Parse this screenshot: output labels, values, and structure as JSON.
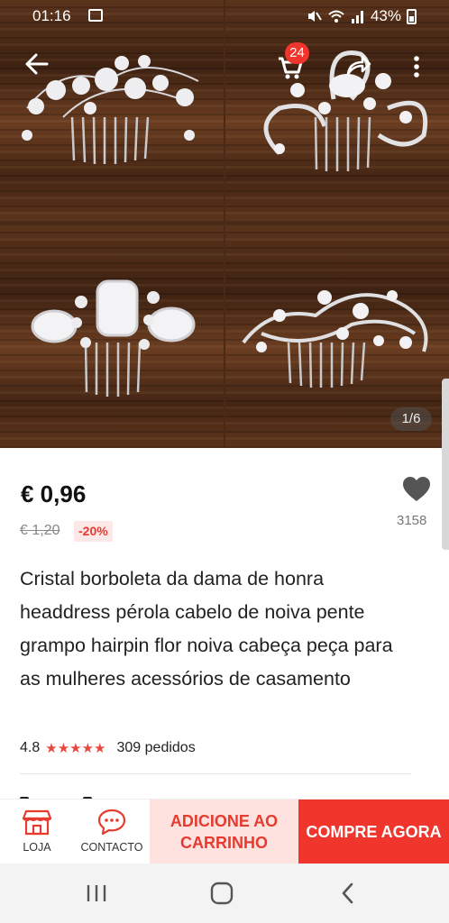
{
  "status_bar": {
    "time": "01:16",
    "battery": "43%"
  },
  "header": {
    "cart_count": "24",
    "icons": [
      "back-arrow-icon",
      "cart-icon",
      "share-icon",
      "more-vertical-icon"
    ]
  },
  "gallery": {
    "page_indicator": "1/6"
  },
  "product": {
    "price": "€ 0,96",
    "old_price": "€ 1,20",
    "discount": "-20%",
    "wishlist_count": "3158",
    "title": "Cristal borboleta da dama de honra headdress pérola cabelo de noiva pente grampo hairpin flor noiva cabeça peça para as mulheres acessórios de casamento",
    "rating": "4.8",
    "stars": "★★★★★",
    "orders": "309 pedidos"
  },
  "action_bar": {
    "store_label": "LOJA",
    "contact_label": "CONTACTO",
    "add_to_cart_label": "ADICIONE AO CARRINHO",
    "buy_now_label": "COMPRE AGORA"
  },
  "colors": {
    "accent": "#f0352d",
    "accent_light": "#fde2e0",
    "discount_text": "#e63b2e"
  }
}
